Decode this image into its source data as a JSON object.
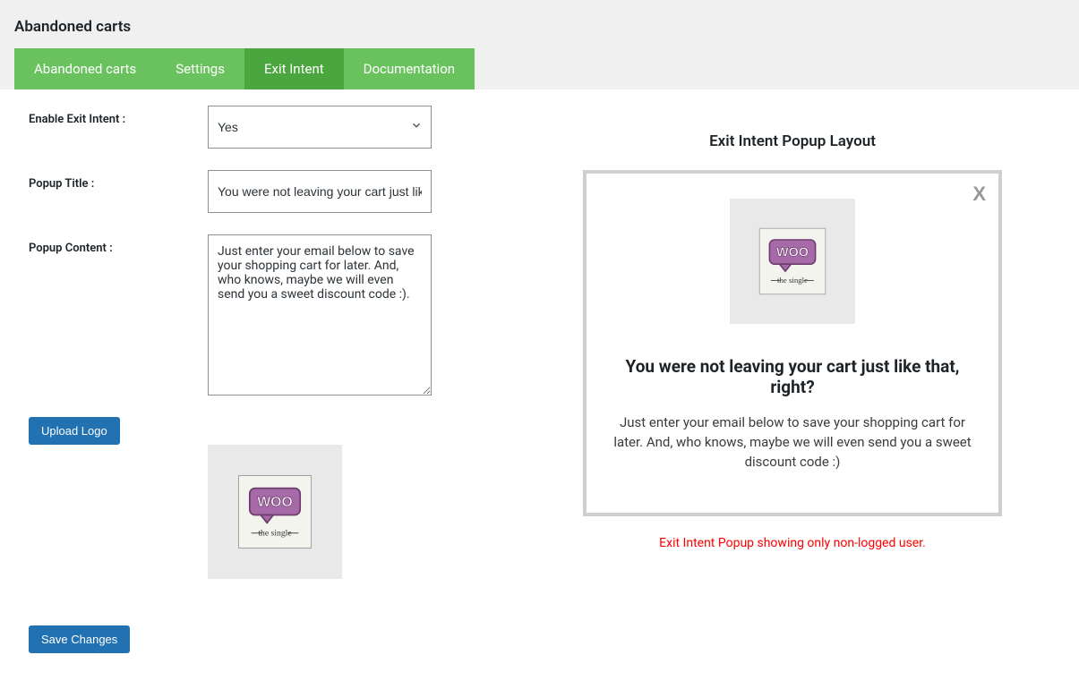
{
  "page": {
    "title": "Abandoned carts"
  },
  "tabs": {
    "items": [
      {
        "label": "Abandoned carts",
        "active": false
      },
      {
        "label": "Settings",
        "active": false
      },
      {
        "label": "Exit Intent",
        "active": true
      },
      {
        "label": "Documentation",
        "active": false
      }
    ]
  },
  "form": {
    "enable_label": "Enable Exit Intent :",
    "enable_value": "Yes",
    "title_label": "Popup Title :",
    "title_value": "You were not leaving your cart just like that, right?",
    "content_label": "Popup Content :",
    "content_value": "Just enter your email below to save your shopping cart for later. And, who knows, maybe we will even send you a sweet discount code :).",
    "upload_label": "Upload Logo",
    "save_label": "Save Changes"
  },
  "preview": {
    "heading": "Exit Intent Popup Layout",
    "popup_title": "You were not leaving your cart just like that, right?",
    "popup_text": "Just enter your email below to save your shopping cart for later. And, who knows, maybe we will even send you a sweet discount code :)",
    "close_label": "X",
    "notice": "Exit Intent Popup showing only non-logged user."
  }
}
